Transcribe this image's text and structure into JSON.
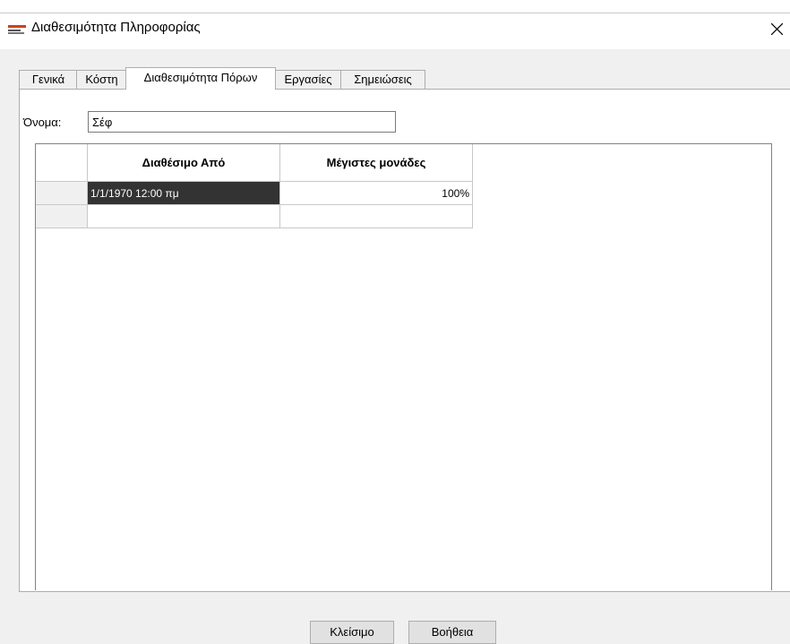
{
  "window": {
    "title": "Διαθεσιμότητα Πληροφορίας",
    "icon": "app-icon"
  },
  "tabs": [
    {
      "label": "Γενικά",
      "active": false
    },
    {
      "label": "Κόστη",
      "active": false
    },
    {
      "label": "Διαθεσιμότητα Πόρων",
      "active": true
    },
    {
      "label": "Εργασίες",
      "active": false
    },
    {
      "label": "Σημειώσεις",
      "active": false
    }
  ],
  "name": {
    "label": "Όνομα:",
    "value": "Σέφ"
  },
  "table": {
    "columns": [
      "Διαθέσιμο Από",
      "Μέγιστες μονάδες"
    ],
    "rows": [
      [
        "1/1/1970 12:00 πμ",
        "100%"
      ],
      [
        "",
        ""
      ]
    ]
  },
  "buttons": {
    "close": "Κλείσιμο",
    "help": "Βοήθεια"
  }
}
